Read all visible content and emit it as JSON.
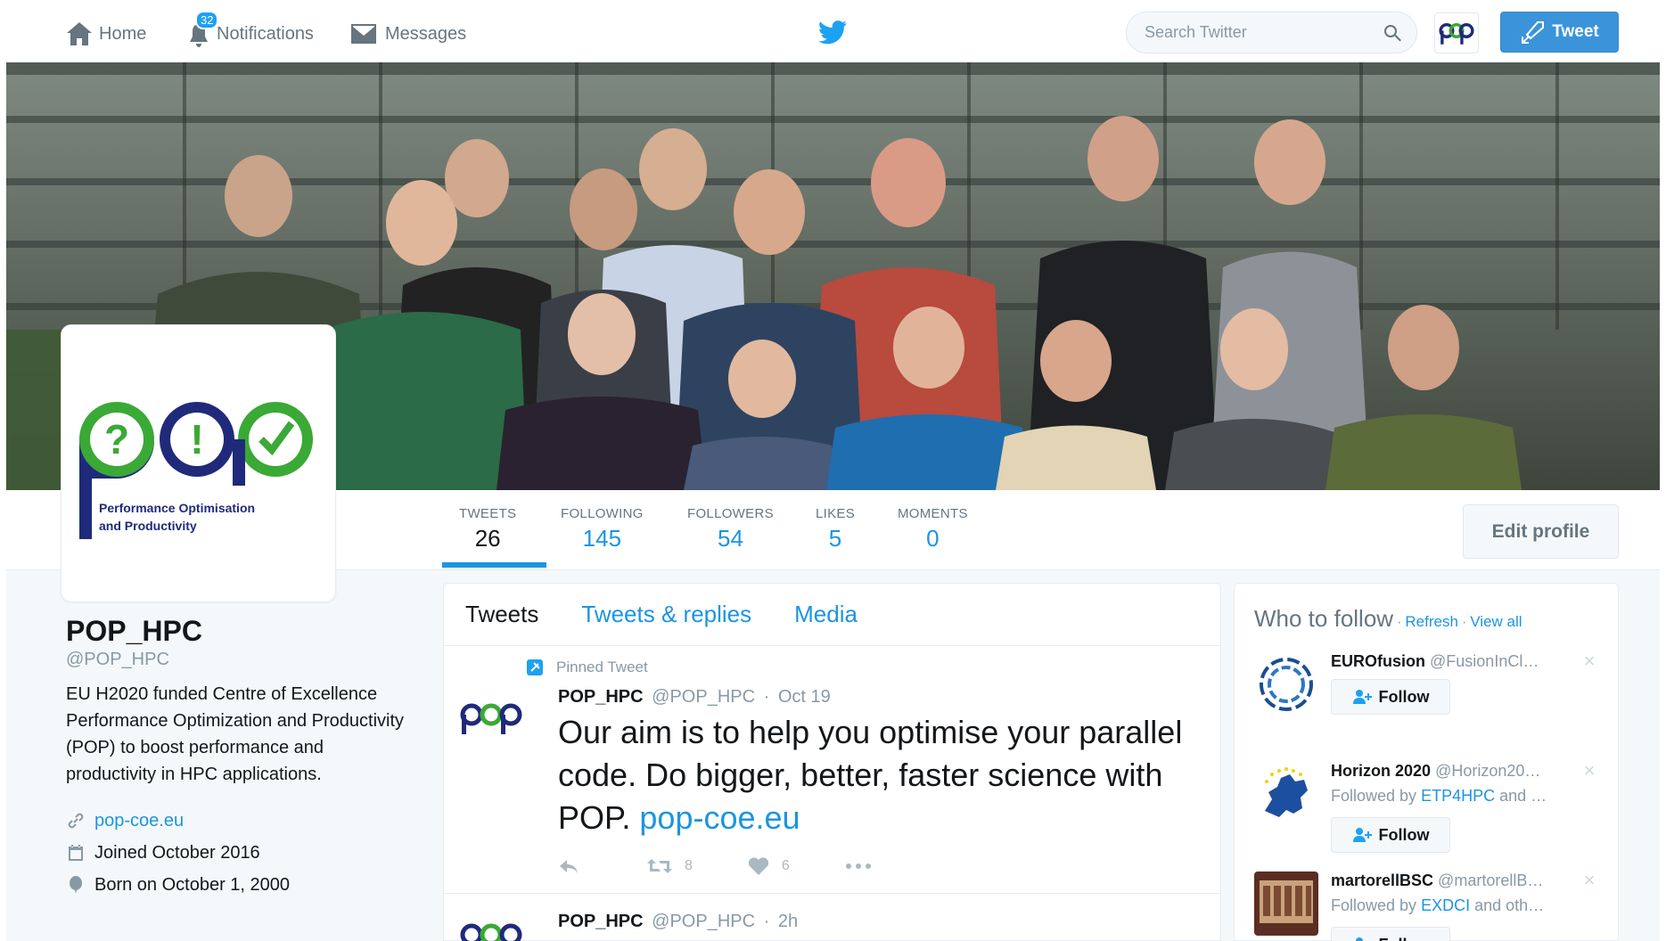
{
  "nav": {
    "home_label": "Home",
    "notifications_label": "Notifications",
    "notifications_count": "32",
    "messages_label": "Messages",
    "search_placeholder": "Search Twitter",
    "tweet_button_label": "Tweet"
  },
  "profile": {
    "name": "POP_HPC",
    "handle": "@POP_HPC",
    "bio": "EU H2020 funded Centre of Excellence Performance Optimization and Productivity (POP) to boost performance and productivity in HPC applications.",
    "website": "pop-coe.eu",
    "joined": "Joined October 2016",
    "born": "Born on October 1, 2000",
    "logo_text_line1": "Performance Optimisation",
    "logo_text_line2": "and Productivity"
  },
  "stats": [
    {
      "label": "TWEETS",
      "value": "26"
    },
    {
      "label": "FOLLOWING",
      "value": "145"
    },
    {
      "label": "FOLLOWERS",
      "value": "54"
    },
    {
      "label": "LIKES",
      "value": "5"
    },
    {
      "label": "MOMENTS",
      "value": "0"
    }
  ],
  "edit_profile_label": "Edit profile",
  "timeline": {
    "tabs": [
      "Tweets",
      "Tweets & replies",
      "Media"
    ],
    "pinned_label": "Pinned Tweet",
    "tweets": [
      {
        "name": "POP_HPC",
        "handle": "@POP_HPC",
        "time": "Oct 19",
        "text": "Our aim is to help you optimise your parallel code. Do bigger, better, faster science with POP.",
        "link": "pop-coe.eu",
        "retweets": "8",
        "likes": "6"
      },
      {
        "name": "POP_HPC",
        "handle": "@POP_HPC",
        "time": "2h"
      }
    ]
  },
  "who_to_follow": {
    "title": "Who to follow",
    "refresh": "Refresh",
    "view_all": "View all",
    "follow_label": "Follow",
    "items": [
      {
        "name": "EUROfusion",
        "handle": "@FusionInCl…",
        "followed_by": ""
      },
      {
        "name": "Horizon 2020",
        "handle": "@Horizon20…",
        "followed_by_prefix": "Followed by",
        "followed_by_link": "ETP4HPC",
        "followed_by_suffix": "and …"
      },
      {
        "name": "martorellBSC",
        "handle": "@martorellB…",
        "followed_by_prefix": "Followed by",
        "followed_by_link": "EXDCI",
        "followed_by_suffix": "and oth…"
      }
    ]
  },
  "colors": {
    "accent": "#1da1f2",
    "link": "#1b95e0",
    "pop_green": "#3aa935",
    "pop_navy": "#1f2a7a"
  }
}
